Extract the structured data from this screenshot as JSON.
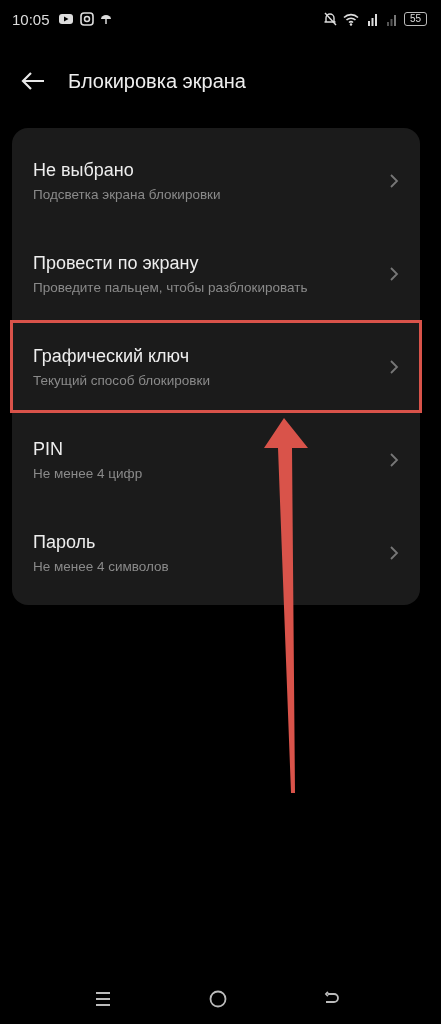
{
  "status_bar": {
    "time": "10:05",
    "battery": "55"
  },
  "header": {
    "title": "Блокировка экрана"
  },
  "options": [
    {
      "title": "Не выбрано",
      "subtitle": "Подсветка экрана блокировки",
      "highlighted": false
    },
    {
      "title": "Провести по экрану",
      "subtitle": "Проведите пальцем, чтобы разблокировать",
      "highlighted": false
    },
    {
      "title": "Графический ключ",
      "subtitle": "Текущий способ блокировки",
      "highlighted": true
    },
    {
      "title": "PIN",
      "subtitle": "Не менее 4 цифр",
      "highlighted": false
    },
    {
      "title": "Пароль",
      "subtitle": "Не менее 4 символов",
      "highlighted": false
    }
  ]
}
